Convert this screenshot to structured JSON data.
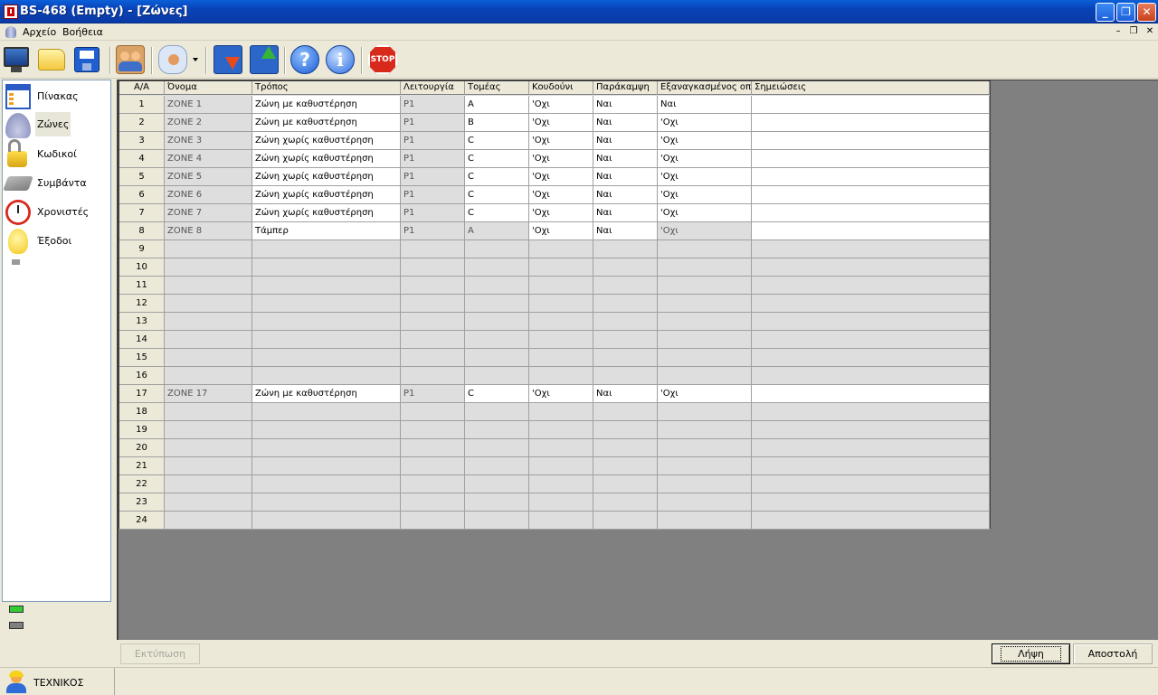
{
  "window": {
    "title": "BS-468 (Empty) - [Ζώνες]"
  },
  "menu": {
    "items": [
      "Αρχείο",
      "Βοήθεια"
    ]
  },
  "toolbar": {
    "buttons": [
      "monitor-icon",
      "open-folder-icon",
      "save-icon",
      "users-icon",
      "user-talk-icon",
      "download-icon",
      "upload-icon",
      "help-icon",
      "info-icon",
      "stop-icon"
    ],
    "stop_label": "STOP"
  },
  "nav": {
    "items": [
      {
        "label": "Πίνακας",
        "icon": "board-icon"
      },
      {
        "label": "Ζώνες",
        "icon": "bell-icon",
        "selected": true
      },
      {
        "label": "Κωδικοί",
        "icon": "lock-icon"
      },
      {
        "label": "Συμβάντα",
        "icon": "events-icon"
      },
      {
        "label": "Χρονιστές",
        "icon": "alarm-clock-icon"
      },
      {
        "label": "Έξοδοι",
        "icon": "bulb-icon"
      }
    ],
    "leds": [
      "#33cc33",
      "#808080"
    ]
  },
  "grid": {
    "headers": [
      "Α/Α",
      "Όνομα",
      "Τρόπος",
      "Λειτουργία",
      "Τομέας",
      "Κουδούνι",
      "Παράκαμψη",
      "Εξαναγκασμένος οπ",
      "Σημειώσεις"
    ],
    "rows": [
      {
        "n": "1",
        "name": "ZONE 1",
        "mode": "Ζώνη με καθυστέρηση",
        "func": "P1",
        "sector": "A",
        "bell": "'Οχι",
        "bypass": "Ναι",
        "forced": "Ναι",
        "notes": "",
        "state": "w"
      },
      {
        "n": "2",
        "name": "ZONE 2",
        "mode": "Ζώνη με καθυστέρηση",
        "func": "P1",
        "sector": "B",
        "bell": "'Οχι",
        "bypass": "Ναι",
        "forced": "'Οχι",
        "notes": "",
        "state": "w"
      },
      {
        "n": "3",
        "name": "ZONE 3",
        "mode": "Ζώνη χωρίς καθυστέρηση",
        "func": "P1",
        "sector": "C",
        "bell": "'Οχι",
        "bypass": "Ναι",
        "forced": "'Οχι",
        "notes": "",
        "state": "w"
      },
      {
        "n": "4",
        "name": "ZONE 4",
        "mode": "Ζώνη χωρίς καθυστέρηση",
        "func": "P1",
        "sector": "C",
        "bell": "'Οχι",
        "bypass": "Ναι",
        "forced": "'Οχι",
        "notes": "",
        "state": "w"
      },
      {
        "n": "5",
        "name": "ZONE 5",
        "mode": "Ζώνη χωρίς καθυστέρηση",
        "func": "P1",
        "sector": "C",
        "bell": "'Οχι",
        "bypass": "Ναι",
        "forced": "'Οχι",
        "notes": "",
        "state": "w"
      },
      {
        "n": "6",
        "name": "ZONE 6",
        "mode": "Ζώνη χωρίς καθυστέρηση",
        "func": "P1",
        "sector": "C",
        "bell": "'Οχι",
        "bypass": "Ναι",
        "forced": "'Οχι",
        "notes": "",
        "state": "w"
      },
      {
        "n": "7",
        "name": "ZONE 7",
        "mode": "Ζώνη χωρίς καθυστέρηση",
        "func": "P1",
        "sector": "C",
        "bell": "'Οχι",
        "bypass": "Ναι",
        "forced": "'Οχι",
        "notes": "",
        "state": "w"
      },
      {
        "n": "8",
        "name": "ZONE 8",
        "mode": "Τάμπερ",
        "func": "P1",
        "sector": "A",
        "bell": "'Οχι",
        "bypass": "Ναι",
        "forced": "'Οχι",
        "notes": "",
        "state": "tamper"
      },
      {
        "n": "9",
        "state": "e"
      },
      {
        "n": "10",
        "state": "e"
      },
      {
        "n": "11",
        "state": "e"
      },
      {
        "n": "12",
        "state": "e"
      },
      {
        "n": "13",
        "state": "e"
      },
      {
        "n": "14",
        "state": "e"
      },
      {
        "n": "15",
        "state": "e"
      },
      {
        "n": "16",
        "state": "e"
      },
      {
        "n": "17",
        "name": "ZONE 17",
        "mode": "Ζώνη με καθυστέρηση",
        "func": "P1",
        "sector": "C",
        "bell": "'Οχι",
        "bypass": "Ναι",
        "forced": "'Οχι",
        "notes": "",
        "state": "w"
      },
      {
        "n": "18",
        "state": "e"
      },
      {
        "n": "19",
        "state": "e"
      },
      {
        "n": "20",
        "state": "e"
      },
      {
        "n": "21",
        "state": "e"
      },
      {
        "n": "22",
        "state": "e"
      },
      {
        "n": "23",
        "state": "e"
      },
      {
        "n": "24",
        "state": "e"
      }
    ]
  },
  "buttons": {
    "print": "Εκτύπωση",
    "receive": "Λήψη",
    "send": "Αποστολή"
  },
  "status": {
    "user": "ΤΕΧΝΙΚΟΣ"
  }
}
